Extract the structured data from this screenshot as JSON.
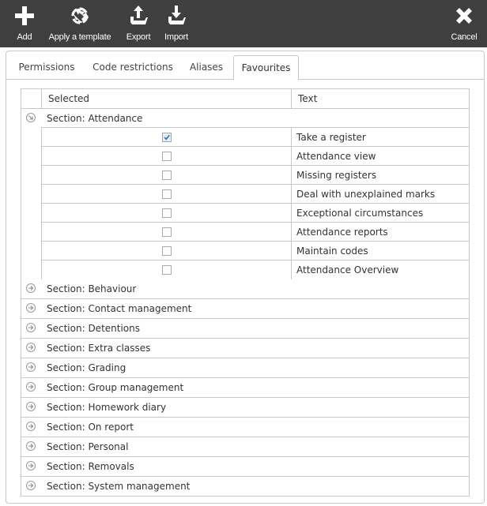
{
  "toolbar": {
    "add_label": "Add",
    "apply_template_label": "Apply a template",
    "export_label": "Export",
    "import_label": "Import",
    "cancel_label": "Cancel",
    "icons": {
      "add": "plus-icon",
      "apply_template": "recycle-arrows-icon",
      "export": "export-tray-up-icon",
      "import": "import-tray-down-icon",
      "cancel": "close-x-icon"
    }
  },
  "tabs": [
    {
      "label": "Permissions",
      "active": false
    },
    {
      "label": "Code restrictions",
      "active": false
    },
    {
      "label": "Aliases",
      "active": false
    },
    {
      "label": "Favourites",
      "active": true
    }
  ],
  "table": {
    "columns": [
      "Selected",
      "Text"
    ],
    "expanded_section": {
      "label": "Section: Attendance",
      "items": [
        {
          "text": "Take a register",
          "selected": true
        },
        {
          "text": "Attendance view",
          "selected": false
        },
        {
          "text": "Missing registers",
          "selected": false
        },
        {
          "text": "Deal with unexplained marks",
          "selected": false
        },
        {
          "text": "Exceptional circumstances",
          "selected": false
        },
        {
          "text": "Attendance reports",
          "selected": false
        },
        {
          "text": "Maintain codes",
          "selected": false
        },
        {
          "text": "Attendance Overview",
          "selected": false
        }
      ]
    },
    "collapsed_sections": [
      "Section: Behaviour",
      "Section: Contact management",
      "Section: Detentions",
      "Section: Extra classes",
      "Section: Grading",
      "Section: Group management",
      "Section: Homework diary",
      "Section: On report",
      "Section: Personal",
      "Section: Removals",
      "Section: System management"
    ]
  },
  "colors": {
    "toolbar_bg": "#3f3f3f",
    "toolbar_text": "#ffffff",
    "border": "#c8c8c8",
    "check_accent": "#2f6db5"
  }
}
